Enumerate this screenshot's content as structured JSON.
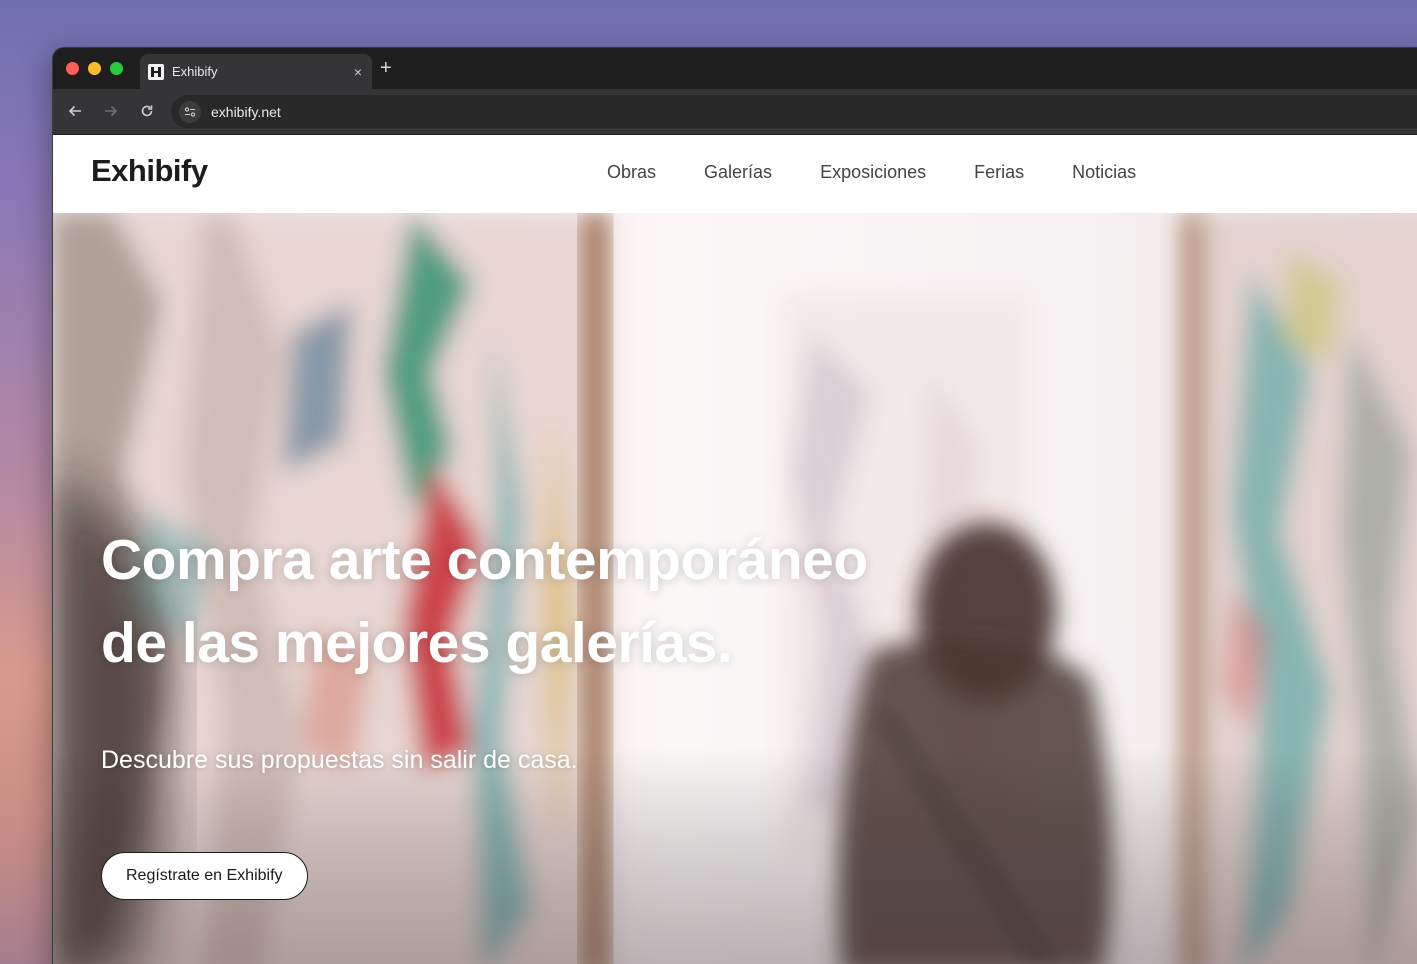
{
  "browser": {
    "tab_title": "Exhibify",
    "new_tab_symbol": "+",
    "close_symbol": "×",
    "url": "exhibify.net"
  },
  "site": {
    "logo": "Exhibify",
    "nav": [
      {
        "label": "Obras"
      },
      {
        "label": "Galerías"
      },
      {
        "label": "Exposiciones"
      },
      {
        "label": "Ferias"
      },
      {
        "label": "Noticias"
      }
    ]
  },
  "hero": {
    "title_line1": "Compra arte contemporáneo",
    "title_line2": "de las mejores galerías.",
    "subtitle": "Descubre sus propuestas sin salir de casa.",
    "cta_label": "Regístrate en Exhibify"
  },
  "colors": {
    "traffic_red": "#fe5f57",
    "traffic_yellow": "#febc2e",
    "traffic_green": "#28c840",
    "browser_dark": "#1e1e1f",
    "text_dark": "#1c1c1c"
  },
  "icons": {
    "back": "arrow-left-icon",
    "forward": "arrow-right-icon",
    "reload": "reload-icon",
    "site_info": "tune-icon",
    "favicon": "exhibify-favicon-icon"
  }
}
